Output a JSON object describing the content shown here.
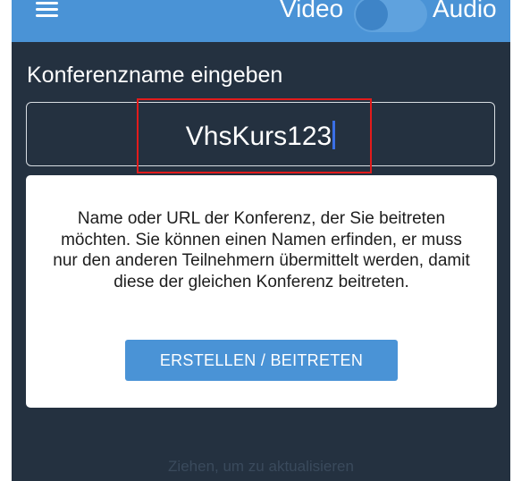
{
  "header": {
    "menu_icon": "hamburger-menu-icon",
    "video_label": "Video",
    "audio_label": "Audio",
    "audio_only_toggle": "off"
  },
  "conference": {
    "prompt_label": "Konferenzname eingeben",
    "name_value": "VhsKurs123",
    "help_text": "Name oder URL der Konferenz, der Sie beitreten möchten. Sie können einen Namen erfinden, er muss nur den anderen Teilnehmern übermittelt werden, damit diese der gleichen Konferenz beitreten.",
    "join_button_label": "ERSTELLEN / BEITRETEN"
  },
  "footer": {
    "pull_to_refresh": "Ziehen, um zu aktualisieren"
  },
  "colors": {
    "accent": "#4a93d6",
    "background": "#243140",
    "highlight": "#e21b1b"
  }
}
